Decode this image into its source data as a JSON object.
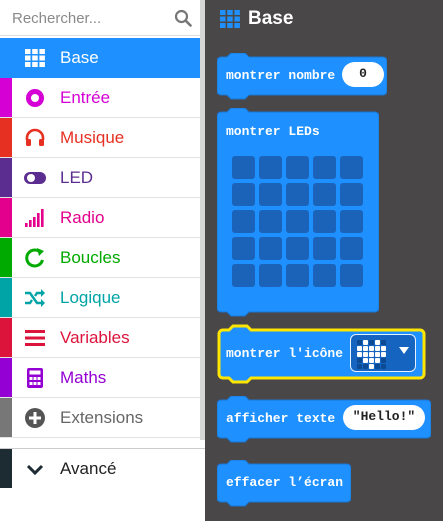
{
  "search": {
    "placeholder": "Rechercher..."
  },
  "toolbox": {
    "categories": [
      {
        "label": "Base",
        "color": "#1e90ff",
        "icon": "grid-icon",
        "selected": true
      },
      {
        "label": "Entrée",
        "color": "#d400d4",
        "icon": "target-icon",
        "selected": false
      },
      {
        "label": "Musique",
        "color": "#e63022",
        "icon": "headphones-icon",
        "selected": false
      },
      {
        "label": "LED",
        "color": "#5c2d91",
        "icon": "toggle-icon",
        "selected": false
      },
      {
        "label": "Radio",
        "color": "#e3008c",
        "icon": "signal-bars-icon",
        "selected": false
      },
      {
        "label": "Boucles",
        "color": "#00aa00",
        "icon": "refresh-icon",
        "selected": false
      },
      {
        "label": "Logique",
        "color": "#00a4a6",
        "icon": "shuffle-icon",
        "selected": false
      },
      {
        "label": "Variables",
        "color": "#dc143c",
        "icon": "list-icon",
        "selected": false
      },
      {
        "label": "Maths",
        "color": "#9400d3",
        "icon": "calculator-icon",
        "selected": false
      },
      {
        "label": "Extensions",
        "color": "#777777",
        "icon": "plus-circle-icon",
        "selected": false
      }
    ],
    "advanced": {
      "label": "Avancé",
      "icon": "chevron-down-icon",
      "color": "#1d2b33"
    }
  },
  "flyout": {
    "title": "Base",
    "blocks": {
      "show_number": {
        "label": "montrer nombre",
        "value": "0"
      },
      "show_leds": {
        "label": "montrer LEDs"
      },
      "show_icon": {
        "label": "montrer l'icône",
        "icon": "heart-icon"
      },
      "show_string": {
        "label": "afficher texte",
        "value": "\"Hello!\""
      },
      "clear_screen": {
        "label": "effacer l’écran"
      }
    }
  },
  "colors": {
    "block": "#1e90ff",
    "block_edge": "#1976d2",
    "highlight": "#ffe600",
    "flyout_bg": "#4a4748"
  }
}
